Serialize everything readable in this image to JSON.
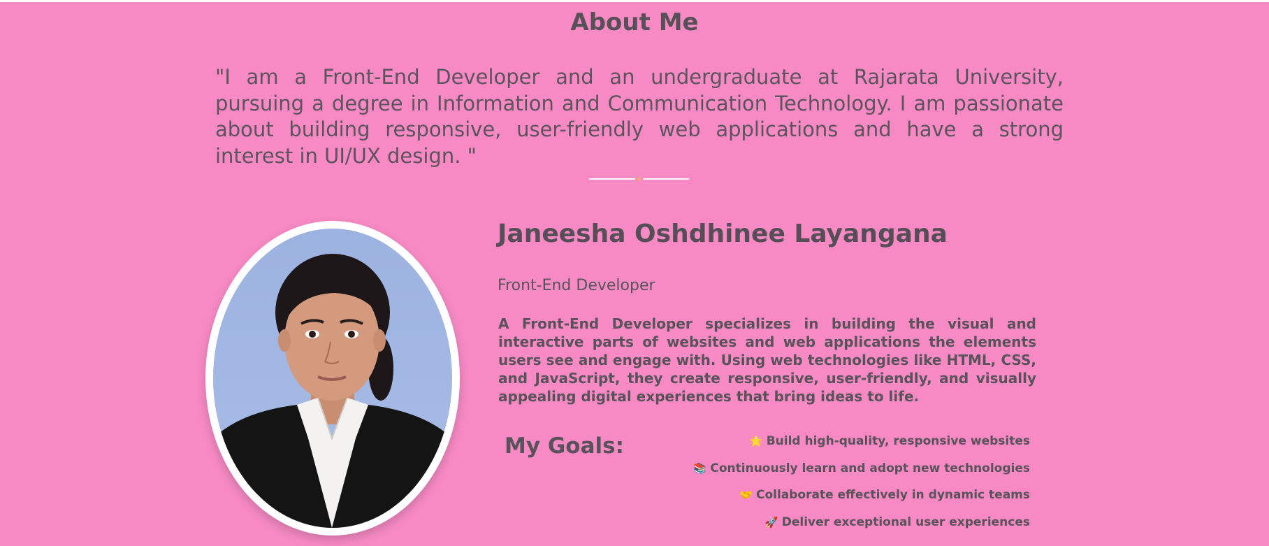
{
  "about": {
    "heading": "About Me",
    "quote": "\"I am a Front-End Developer and an undergraduate at Rajarata University, pursuing a degree in Information and Communication Technology. I am passionate about building responsive, user-friendly web applications and have a strong interest in UI/UX design. \""
  },
  "profile": {
    "name": "Janeesha Oshdhinee Layangana",
    "role": "Front-End Developer",
    "description": "A Front-End Developer specializes in building the visual and interactive parts of websites and web applications the elements users see and engage with. Using web technologies like HTML, CSS, and JavaScript, they create responsive, user-friendly, and visually appealing digital experiences that bring ideas to life."
  },
  "goals": {
    "title": "My Goals:",
    "items": [
      {
        "icon": "sparkle-icon",
        "glyph": "🌟",
        "text": "Build high-quality, responsive websites"
      },
      {
        "icon": "books-icon",
        "glyph": "📚",
        "text": "Continuously learn and adopt new technologies"
      },
      {
        "icon": "handshake-icon",
        "glyph": "🤝",
        "text": "Collaborate effectively in dynamic teams"
      },
      {
        "icon": "rocket-icon",
        "glyph": "🚀",
        "text": "Deliver exceptional user experiences"
      }
    ]
  },
  "colors": {
    "background": "#f78ac4",
    "text": "#585058",
    "divider_dot": "#f6a77a",
    "portrait_border": "#ffffff"
  }
}
